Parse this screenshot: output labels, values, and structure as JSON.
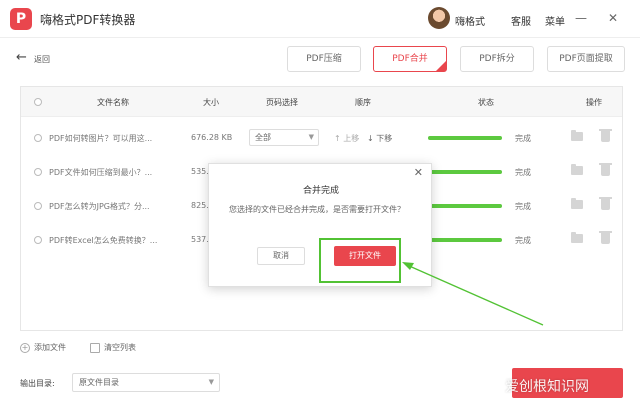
{
  "app": {
    "title": "嗨格式PDF转换器",
    "user_name": "嗨格式",
    "service_label": "客服",
    "menu_label": "菜单",
    "minimize_glyph": "—",
    "close_glyph": "✕",
    "logo_glyph": "P"
  },
  "nav": {
    "back_label": "返回",
    "back_glyph": "←"
  },
  "tools": [
    {
      "label": "PDF压缩",
      "active": false
    },
    {
      "label": "PDF合并",
      "active": true
    },
    {
      "label": "PDF拆分",
      "active": false
    },
    {
      "label": "PDF页面提取",
      "active": false
    }
  ],
  "table": {
    "headers": {
      "name": "文件名称",
      "size": "大小",
      "pages": "页码选择",
      "order": "顺序",
      "status": "状态",
      "actions": "操作"
    },
    "rows": [
      {
        "name": "PDF如何转图片？可以用这...",
        "size": "676.28 KB",
        "pages": "全部",
        "order_up": "↑ 上移",
        "order_down": "↓ 下移",
        "status": "完成",
        "progress": 1.0
      },
      {
        "name": "PDF文件如何压缩到最小？...",
        "size": "535.",
        "status": "完成",
        "progress": 1.0
      },
      {
        "name": "PDF怎么转为JPG格式？分...",
        "size": "825.",
        "status": "完成",
        "progress": 1.0
      },
      {
        "name": "PDF转Excel怎么免费转换？...",
        "size": "537.",
        "status": "完成",
        "progress": 1.0
      }
    ]
  },
  "footer": {
    "add_file": "添加文件",
    "clear_list": "清空列表",
    "output_label": "输出目录:",
    "output_value": "原文件目录"
  },
  "dialog": {
    "title": "合并完成",
    "message": "您选择的文件已经合并完成，是否需要打开文件？",
    "cancel_label": "取消",
    "open_label": "打开文件",
    "close_glyph": "✕"
  },
  "watermark": "爱创根知识网",
  "colors": {
    "accent": "#e9464d",
    "progress": "#5cc93f",
    "annotation": "#52c234"
  }
}
